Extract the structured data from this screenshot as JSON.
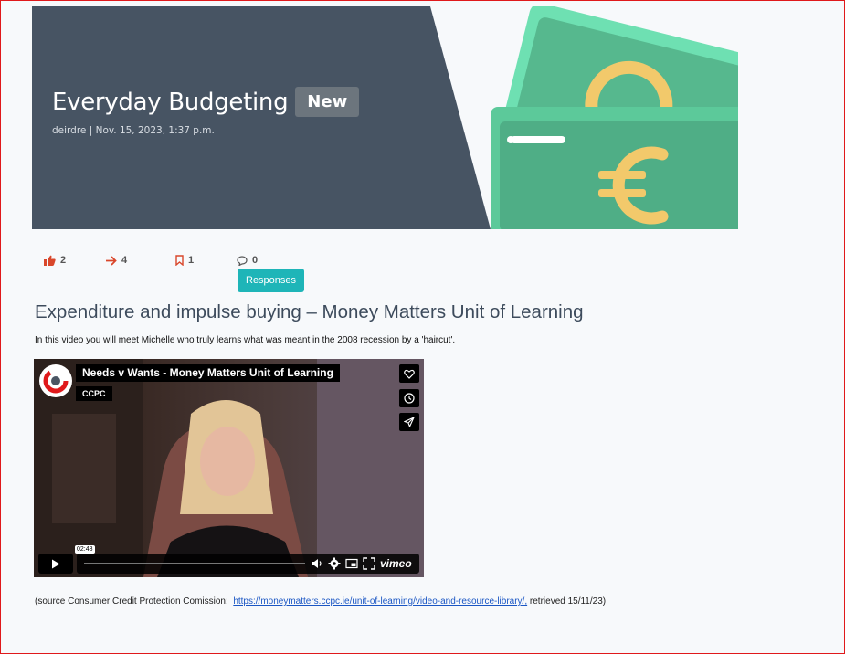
{
  "banner": {
    "title": "Everyday Budgeting",
    "badge": "New",
    "meta": "deirdre | Nov. 15, 2023, 1:37 p.m."
  },
  "stats": {
    "likes": "2",
    "shares": "4",
    "bookmarks": "1",
    "comments": "0"
  },
  "responses_button": "Responses",
  "article": {
    "heading": "Expenditure and impulse buying – Money Matters Unit of Learning",
    "intro": "In this video you will meet Michelle who truly learns what was meant in the 2008 recession by a 'haircut'."
  },
  "video": {
    "title": "Needs v Wants - Money Matters Unit of Learning",
    "author": "CCPC",
    "timestamp": "02:48",
    "brand": "vimeo"
  },
  "source": {
    "prefix": "(source Consumer Credit Protection Comission:",
    "link": "https://moneymatters.ccpc.ie/unit-of-learning/video-and-resource-library/,",
    "suffix": "retrieved 15/11/23)"
  },
  "colors": {
    "banner_bg": "#475463",
    "accent_teal": "#1eb5b8",
    "money_green": "#5cc99a",
    "euro_gold": "#f2c96b",
    "icon_red": "#d9472b"
  }
}
